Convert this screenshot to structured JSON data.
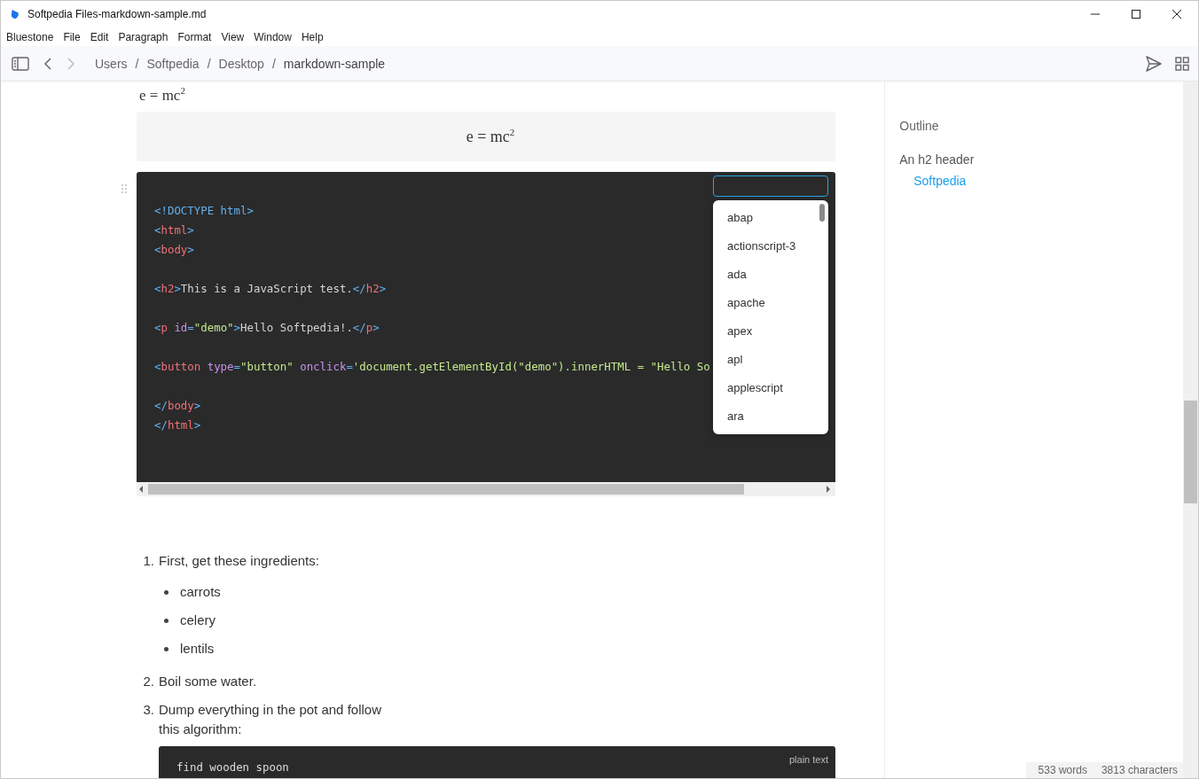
{
  "window": {
    "title": "Softpedia Files-markdown-sample.md"
  },
  "menu": [
    "Bluestone",
    "File",
    "Edit",
    "Paragraph",
    "Format",
    "View",
    "Window",
    "Help"
  ],
  "breadcrumb": {
    "separator": "/",
    "items": [
      "Users",
      "Softpedia",
      "Desktop",
      "markdown-sample"
    ]
  },
  "editor": {
    "inline_math": "e = mc$^{2}$",
    "block_math": "e = mc$^{2}$",
    "code_block": {
      "line_groups": [
        [
          "<!DOCTYPE html>",
          "<html>",
          "<body>"
        ],
        [
          "<h2>This is a JavaScript test.</h2>"
        ],
        [
          "<p id=\"demo\">Hello Softpedia!.</p>"
        ],
        [
          "<button type=\"button\" onclick='document.getElementById(\"demo\").innerHTML = \"Hello So"
        ],
        [
          "</body>",
          "</html>"
        ]
      ],
      "language_dropdown": {
        "expanded": true,
        "options": [
          "abap",
          "actionscript-3",
          "ada",
          "apache",
          "apex",
          "apl",
          "applescript",
          "ara"
        ]
      }
    },
    "list": [
      {
        "number": "1.",
        "text": "First, get these ingredients:",
        "children": [
          "carrots",
          "celery",
          "lentils"
        ]
      },
      {
        "number": "2.",
        "text": "Boil some water."
      },
      {
        "number": "3.",
        "text": "Dump everything in the pot and follow this algorithm:",
        "code": {
          "language": "plain text",
          "first_line": "find wooden spoon"
        }
      }
    ]
  },
  "outline": {
    "title": "Outline",
    "items": [
      {
        "text": "An h2 header",
        "children": [
          {
            "text": "Softpedia",
            "selected": true
          }
        ],
        "selected": false
      }
    ]
  },
  "status_bar": {
    "words": "533 words",
    "characters": "3813 characters"
  }
}
